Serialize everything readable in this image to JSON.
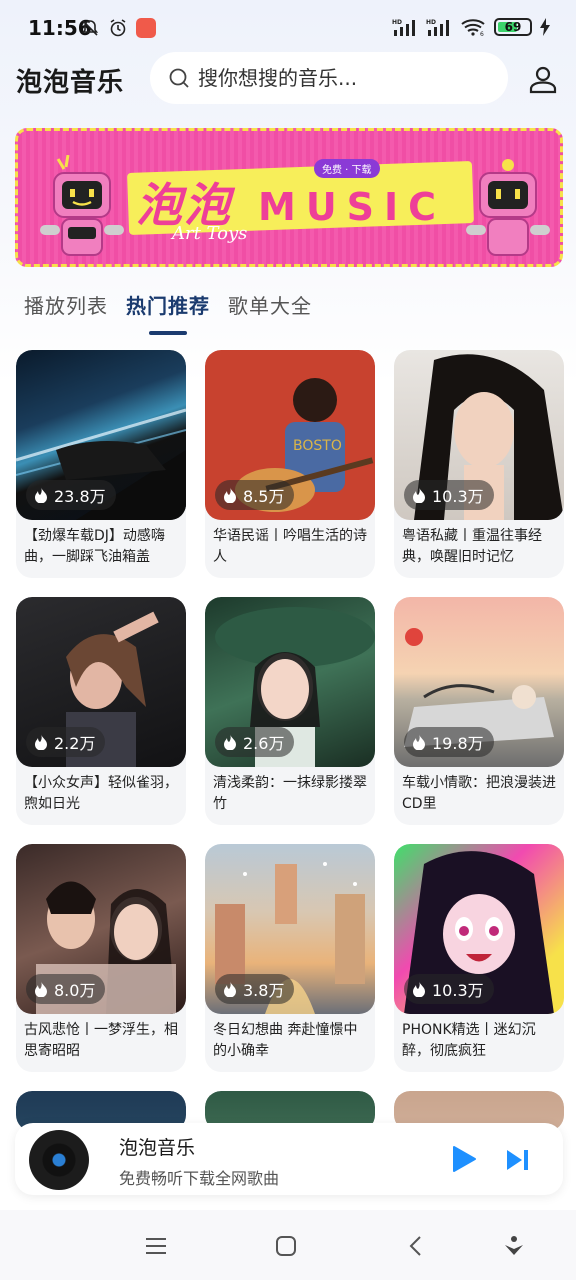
{
  "status_bar": {
    "time": "11:56",
    "battery": "69",
    "battery_level": 0.69,
    "icons": [
      "mute-bell-icon",
      "alarm-icon",
      "app-notification-icon",
      "hd-signal-icon",
      "hd-signal-icon",
      "wifi-icon",
      "battery-icon",
      "charging-icon"
    ],
    "signal_label_1": "HD",
    "signal_label_2": "HD",
    "wifi_label": "6"
  },
  "header": {
    "title": "泡泡音乐",
    "search_placeholder": "搜你想搜的音乐...",
    "user_icon": "user-icon"
  },
  "banner": {
    "title_cn": "泡泡",
    "title_en": "MUSIC",
    "subtitle": "Art Toys",
    "badge": "免费 · 下载"
  },
  "tabs": [
    {
      "label": "播放列表",
      "active": false
    },
    {
      "label": "热门推荐",
      "active": true
    },
    {
      "label": "歌单大全",
      "active": false
    }
  ],
  "playlists": [
    {
      "count": "23.8万",
      "desc": "【劲爆车载DJ】动感嗨曲，一脚踩飞油箱盖"
    },
    {
      "count": "8.5万",
      "desc": "华语民谣丨吟唱生活的诗人"
    },
    {
      "count": "10.3万",
      "desc": "粤语私藏丨重温往事经典，唤醒旧时记忆"
    },
    {
      "count": "2.2万",
      "desc": "【小众女声】轻似雀羽，煦如日光"
    },
    {
      "count": "2.6万",
      "desc": "清浅柔韵：一抹绿影搂翠竹"
    },
    {
      "count": "19.8万",
      "desc": "车载小情歌：把浪漫装进CD里"
    },
    {
      "count": "8.0万",
      "desc": "古风悲怆丨一梦浮生，相思寄昭昭"
    },
    {
      "count": "3.8万",
      "desc": "冬日幻想曲 奔赴憧憬中的小确幸"
    },
    {
      "count": "10.3万",
      "desc": "PHONK精选丨迷幻沉醉，彻底疯狂"
    }
  ],
  "mini_player": {
    "title": "泡泡音乐",
    "subtitle": "免费畅听下载全网歌曲"
  },
  "colors": {
    "accent": "#1b3b6f",
    "player_accent": "#1e90ff",
    "banner_pink": "#f04ea5",
    "banner_yellow": "#f7ee5a"
  }
}
